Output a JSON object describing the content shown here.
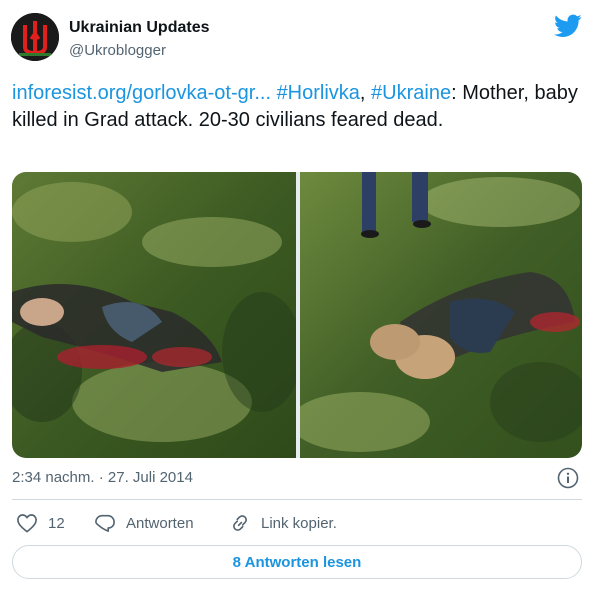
{
  "author": {
    "display_name": "Ukrainian Updates",
    "handle": "@Ukroblogger",
    "avatar_icon": "ukrainian-trident-avatar"
  },
  "tweet": {
    "link_text": "inforesist.org/gorlovka-ot-gr...",
    "hashtag_1": "#Horlivka",
    "separator": ", ",
    "hashtag_2": "#Ukraine",
    "colon": ":",
    "body": " Mother, baby killed in Grad attack. 20-30 civilians feared dead."
  },
  "media": {
    "photo_count": 2
  },
  "timestamp": "2:34 nachm. · 27. Juli 2014",
  "actions": {
    "like_count": "12",
    "reply_label": "Antworten",
    "copy_link_label": "Link kopier."
  },
  "read_replies_label": "8 Antworten lesen",
  "colors": {
    "link": "#1b95e0",
    "text": "#0f1419",
    "secondary": "#536471",
    "border": "#cfd9de",
    "twitter_blue": "#1d9bf0"
  }
}
